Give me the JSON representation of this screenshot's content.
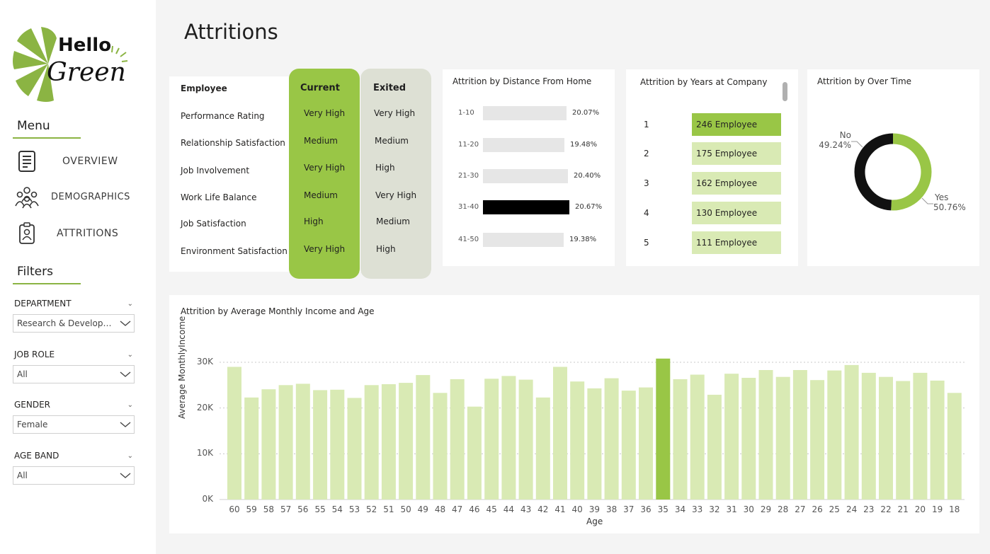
{
  "brand": {
    "word1": "Hello",
    "word2": "Green",
    "accent": "#8bb443"
  },
  "sidebar": {
    "menu_title": "Menu",
    "menu_items": [
      {
        "label": "OVERVIEW",
        "icon": "document-list-icon"
      },
      {
        "label": "DEMOGRAPHICS",
        "icon": "people-group-icon"
      },
      {
        "label": "ATTRITIONS",
        "icon": "id-badge-icon"
      }
    ],
    "filters_title": "Filters",
    "filters": [
      {
        "label": "DEPARTMENT",
        "value": "Research & Developm..."
      },
      {
        "label": "JOB ROLE",
        "value": "All"
      },
      {
        "label": "GENDER",
        "value": "Female"
      },
      {
        "label": "AGE BAND",
        "value": "All"
      }
    ]
  },
  "page": {
    "title": "Attritions"
  },
  "comparison": {
    "header_employee": "Employee",
    "header_current": "Current",
    "header_exited": "Exited",
    "rows": [
      {
        "label": "Performance Rating",
        "current": "Very High",
        "exited": "Very High"
      },
      {
        "label": "Relationship Satisfaction",
        "current": "Medium",
        "exited": "Medium"
      },
      {
        "label": "Job Involvement",
        "current": "Very High",
        "exited": "High"
      },
      {
        "label": "Work Life Balance",
        "current": "Medium",
        "exited": "Very High"
      },
      {
        "label": "Job Satisfaction",
        "current": "High",
        "exited": "Medium"
      },
      {
        "label": "Environment Satisfaction",
        "current": "Very High",
        "exited": "High"
      }
    ],
    "colors": {
      "current": "#99c646",
      "exited": "#dde0d4"
    }
  },
  "distance": {
    "title": "Attrition by Distance From Home",
    "bars": [
      {
        "label": "1-10",
        "value": "20.07%",
        "pct": 20.07,
        "highlight": false
      },
      {
        "label": "11-20",
        "value": "19.48%",
        "pct": 19.48,
        "highlight": false
      },
      {
        "label": "21-30",
        "value": "20.40%",
        "pct": 20.4,
        "highlight": false
      },
      {
        "label": "31-40",
        "value": "20.67%",
        "pct": 20.67,
        "highlight": true
      },
      {
        "label": "41-50",
        "value": "19.38%",
        "pct": 19.38,
        "highlight": false
      }
    ]
  },
  "years": {
    "title": "Attrition by Years at Company",
    "rows": [
      {
        "year": "1",
        "label": "246 Employee",
        "highlight": true
      },
      {
        "year": "2",
        "label": "175 Employee",
        "highlight": false
      },
      {
        "year": "3",
        "label": "162 Employee",
        "highlight": false
      },
      {
        "year": "4",
        "label": "130 Employee",
        "highlight": false
      },
      {
        "year": "5",
        "label": "111 Employee",
        "highlight": false
      }
    ]
  },
  "overtime": {
    "title": "Attrition by Over Time",
    "slices": [
      {
        "name": "No",
        "value": "49.24%",
        "pct": 49.24,
        "color": "#111111"
      },
      {
        "name": "Yes",
        "value": "50.76%",
        "pct": 50.76,
        "color": "#99c646"
      }
    ]
  },
  "chart_data": {
    "type": "bar",
    "title": "Attrition by Average Monthly Income and Age",
    "xlabel": "Age",
    "ylabel": "Average MonthlyIncome",
    "ylim": [
      0,
      30000
    ],
    "yticks": [
      "0K",
      "10K",
      "20K",
      "30K"
    ],
    "categories": [
      "60",
      "59",
      "58",
      "57",
      "56",
      "55",
      "54",
      "53",
      "52",
      "51",
      "50",
      "49",
      "48",
      "47",
      "46",
      "45",
      "44",
      "43",
      "42",
      "41",
      "40",
      "39",
      "38",
      "37",
      "36",
      "35",
      "34",
      "33",
      "32",
      "31",
      "30",
      "29",
      "28",
      "27",
      "26",
      "25",
      "24",
      "23",
      "22",
      "21",
      "20",
      "19",
      "18"
    ],
    "values": [
      29000,
      22300,
      24100,
      25000,
      25300,
      23900,
      24000,
      22200,
      25000,
      25200,
      25500,
      27200,
      23300,
      26300,
      20300,
      26400,
      27000,
      26200,
      22300,
      29000,
      25800,
      24300,
      26500,
      23800,
      24500,
      30800,
      26300,
      27300,
      22900,
      27500,
      26600,
      28300,
      26800,
      28300,
      26100,
      28200,
      29400,
      27700,
      26800,
      25900,
      27700,
      26000,
      23300
    ],
    "highlight_category": "35",
    "colors": {
      "bar": "#d9eab4",
      "highlight": "#99c646"
    }
  }
}
